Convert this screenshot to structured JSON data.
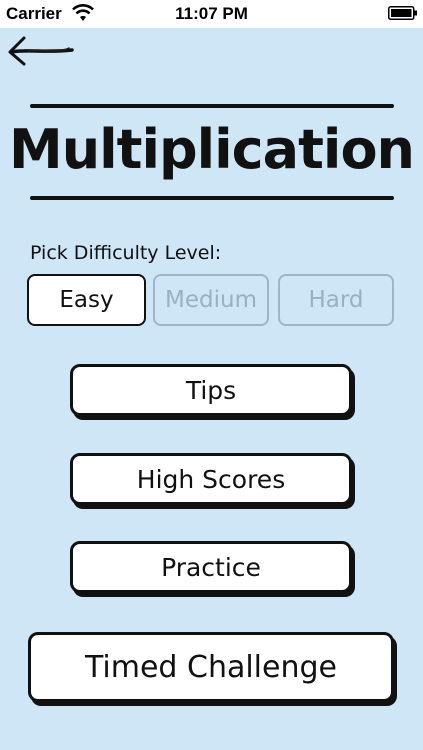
{
  "status_bar": {
    "carrier": "Carrier",
    "time": "11:07 PM",
    "wifi_icon": "wifi-icon",
    "battery_icon": "battery-icon"
  },
  "nav": {
    "back_icon": "back-arrow-icon"
  },
  "title": "Multiplication",
  "difficulty": {
    "label": "Pick Difficulty Level:",
    "options": [
      "Easy",
      "Medium",
      "Hard"
    ],
    "selected": "Easy"
  },
  "menu": {
    "tips": "Tips",
    "high_scores": "High Scores",
    "practice": "Practice",
    "timed_challenge": "Timed Challenge"
  },
  "colors": {
    "background": "#cfe6f7",
    "ink": "#111111",
    "button_fill": "#ffffff",
    "inactive_text": "#9bb0c0"
  }
}
